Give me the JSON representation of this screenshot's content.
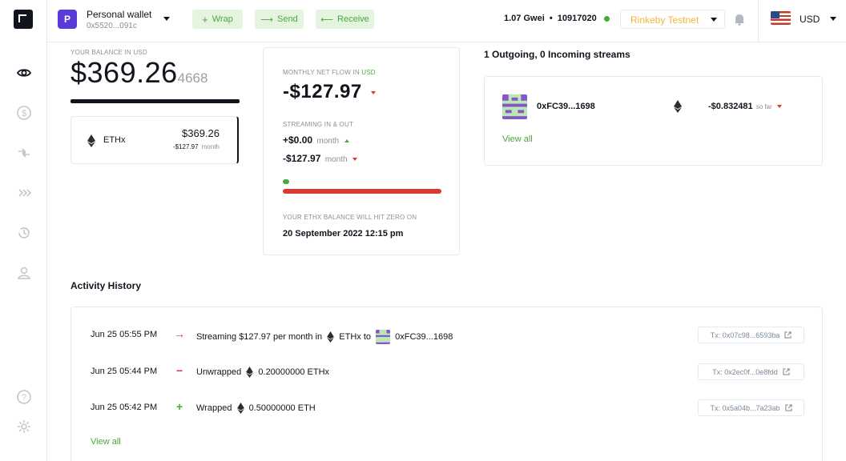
{
  "topbar": {
    "wallet_initial": "P",
    "wallet_name": "Personal wallet",
    "wallet_address": "0x5520...091c",
    "wrap_label": "Wrap",
    "send_label": "Send",
    "receive_label": "Receive",
    "gas_price": "1.07 Gwei",
    "separator": "•",
    "block_number": "10917020",
    "network": "Rinkeby Testnet",
    "currency": "USD"
  },
  "balance": {
    "label": "YOUR BALANCE IN USD",
    "main": "$369.26",
    "decimals": "4668",
    "token": {
      "name": "ETHx",
      "amount": "$369.26",
      "flow": "-$127.97",
      "flow_unit": "month"
    }
  },
  "netflow": {
    "label": "MONTHLY NET FLOW IN ",
    "label_currency": "USD",
    "value": "-$127.97",
    "streaming_label": "STREAMING IN & OUT",
    "in_value": "+$0.00",
    "in_unit": "month",
    "out_value": "-$127.97",
    "out_unit": "month",
    "in_fraction": 0.0,
    "out_fraction": 1.0,
    "zero_label": "YOUR ETHX BALANCE WILL HIT ZERO ON",
    "zero_date": "20 September 2022 12:15 pm"
  },
  "streams": {
    "title": "1 Outgoing, 0 Incoming streams",
    "items": [
      {
        "address": "0xFC39...1698",
        "amount": "-$0.832481",
        "suffix": "so far"
      }
    ],
    "view_all": "View all"
  },
  "activity": {
    "title": "Activity History",
    "rows": [
      {
        "time": "Jun 25 05:55 PM",
        "symbol": "→",
        "prefix": "Streaming $127.97 per month in",
        "token": "ETHx",
        "mid": "to",
        "target": "0xFC39...1698",
        "tx": "Tx: 0x07c98...6593ba"
      },
      {
        "time": "Jun 25 05:44 PM",
        "symbol": "−",
        "prefix": "Unwrapped",
        "token": "0.20000000 ETHx",
        "tx": "Tx: 0x2ec0f...0e8fdd"
      },
      {
        "time": "Jun 25 05:42 PM",
        "symbol": "+",
        "prefix": "Wrapped",
        "token": "0.50000000 ETH",
        "tx": "Tx: 0x5a04b...7a23ab"
      }
    ],
    "view_all": "View all"
  },
  "colors": {
    "accent": "#4ba83c",
    "negative": "#d83a34",
    "network": "#f3b53a",
    "wallet": "#5b3bd8"
  },
  "icons": [
    "logo-icon",
    "eye-icon",
    "dollar-icon",
    "swap-icon",
    "stream-icon",
    "history-icon",
    "user-icon",
    "help-icon",
    "settings-icon",
    "bell-icon",
    "us-flag-icon",
    "eth-icon",
    "external-link-icon"
  ]
}
